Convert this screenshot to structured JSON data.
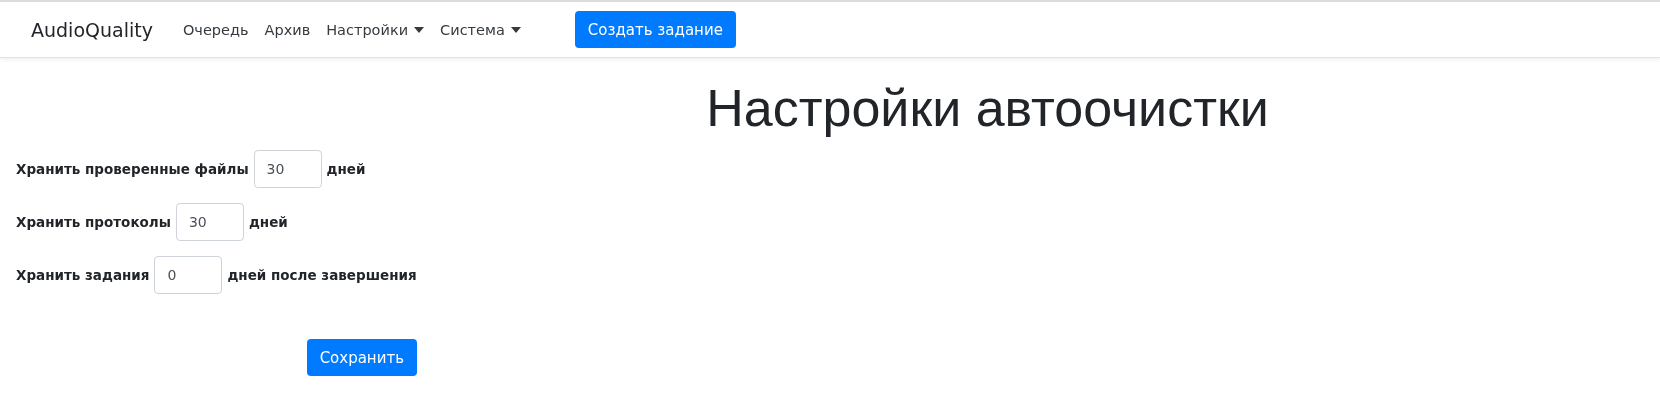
{
  "navbar": {
    "brand": "AudioQuality",
    "items": [
      {
        "label": "Очередь",
        "kind": "link"
      },
      {
        "label": "Архив",
        "kind": "link"
      },
      {
        "label": "Настройки",
        "kind": "dropdown"
      },
      {
        "label": "Система",
        "kind": "dropdown"
      }
    ],
    "action_button": "Создать задание"
  },
  "page": {
    "title": "Настройки автоочистки",
    "fields": [
      {
        "label": "Хранить проверенные файлы",
        "value": "30",
        "suffix": "дней"
      },
      {
        "label": "Хранить протоколы",
        "value": "30",
        "suffix": "дней"
      },
      {
        "label": "Хранить задания",
        "value": "0",
        "suffix": "дней после завершения"
      }
    ],
    "save_button": "Сохранить"
  }
}
